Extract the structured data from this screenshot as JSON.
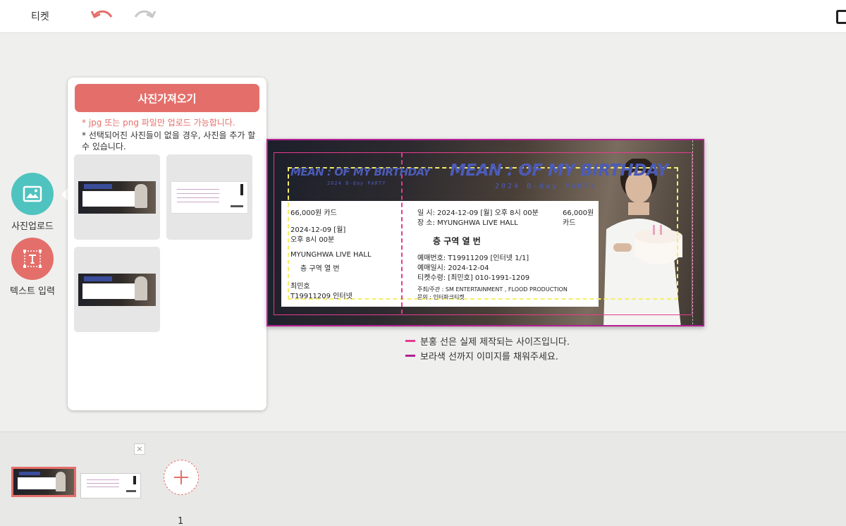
{
  "topbar": {
    "title": "티켓"
  },
  "tools": {
    "photo_upload": "사진업로드",
    "text_input": "텍스트 입력"
  },
  "panel": {
    "import_button": "사진가져오기",
    "note_red": "* jpg 또는 png 파일만 업로드 가능합니다.",
    "note_black": "* 선택되어진 사진들이 없을 경우, 사진을 추가 할 수 있습니다."
  },
  "ticket": {
    "logo": "MEAN : OF MY BIRTHDAY",
    "subtitle": "2024 B-day PARTY",
    "stub": {
      "price_method": "66,000원   카드",
      "date": "2024-12-09 [월]",
      "time": "오후 8시 00분",
      "venue": "MYUNGHWA LIVE HALL",
      "seat": "층     구역     열     번",
      "name": "최민호",
      "booking": "T19911209   인터넷"
    },
    "main": {
      "datetime": "일  시:  2024-12-09 [월] 오후 8시 00분",
      "place": "장  소:  MYUNGHWA LIVE HALL",
      "price": "66,000원",
      "method": "카드",
      "seat": "층     구역     열     번",
      "booking_no": "예매번호:  T19911209  [인터넷 1/1]",
      "booking_date": "예매일시:  2024-12-04",
      "receiver": "티켓수령:  [최민호]  010-1991-1209",
      "organizer": "주최/주관  :  SM ENTERTAINMENT , FLOOD PRODUCTION",
      "inquiry": "문의  :  인터파크티켓"
    }
  },
  "legend": {
    "pink": "분홍 선은 실제 제작되는 사이즈입니다.",
    "purple": "보라색 선까지 이미지를 채워주세요.",
    "pink_color": "#e63b8f",
    "purple_color": "#b41f93"
  },
  "bottom": {
    "page_number": "1",
    "close": "×"
  },
  "colors": {
    "accent_red": "#e46f6a",
    "accent_teal": "#4fc3bf"
  }
}
